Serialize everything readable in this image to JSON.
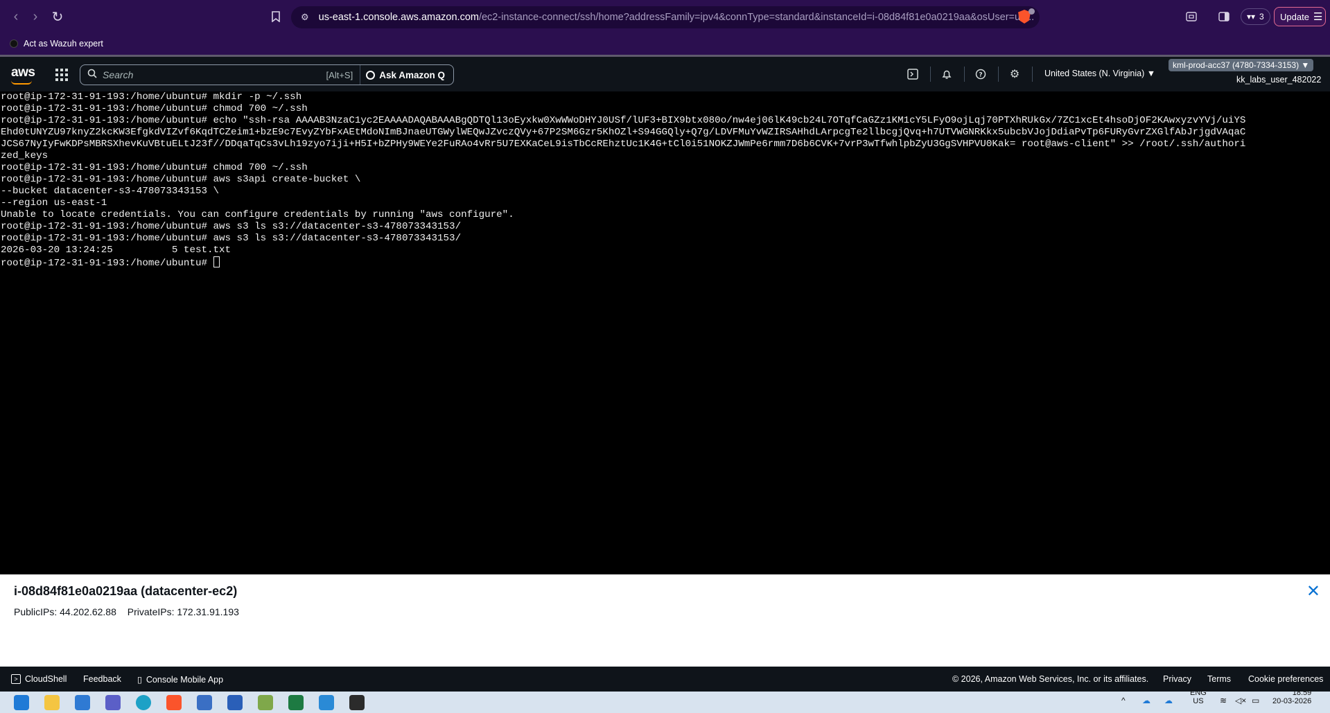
{
  "browser": {
    "url_host": "us-east-1.console.aws.amazon.com",
    "url_path": "/ec2-instance-connect/ssh/home?addressFamily=ipv4&connType=standard&instanceId=i-08d84f81e0a0219aa&osUser=ub...",
    "wallet_count": "3",
    "update_label": "Update"
  },
  "bookmarks": {
    "item": "Act as Wazuh expert"
  },
  "aws_header": {
    "logo": "aws",
    "search_placeholder": "Search",
    "search_shortcut": "[Alt+S]",
    "ask_q": "Ask Amazon Q",
    "region": "United States (N. Virginia) ▼",
    "account": "kml-prod-acc37 (4780-7334-3153) ▼",
    "username": "kk_labs_user_482022"
  },
  "terminal": {
    "lines": [
      "root@ip-172-31-91-193:/home/ubuntu# mkdir -p ~/.ssh",
      "root@ip-172-31-91-193:/home/ubuntu# chmod 700 ~/.ssh",
      "root@ip-172-31-91-193:/home/ubuntu# echo \"ssh-rsa AAAAB3NzaC1yc2EAAAADAQABAAABgQDTQl13oEyxkw0XwWWoDHYJ0USf/lUF3+BIX9btx080o/nw4ej06lK49cb24L7OTqfCaGZz1KM1cY5LFyO9ojLqj70PTXhRUkGx/7ZC1xcEt4hsoDjOF2KAwxyzvYVj/uiYS",
      "Ehd0tUNYZU97knyZ2kcKW3EfgkdVIZvf6KqdTCZeim1+bzE9c7EvyZYbFxAEtMdoNImBJnaeUTGWylWEQwJZvczQVy+67P2SM6Gzr5KhOZl+S94GGQly+Q7g/LDVFMuYvWZIRSAHhdLArpcgTe2llbcgjQvq+h7UTVWGNRKkx5ubcbVJojDdiaPvTp6FURyGvrZXGlfAbJrjgdVAqaC",
      "JCS67NyIyFwKDPsMBRSXhevKuVBtuELtJ23f//DDqaTqCs3vLh19zyo7iji+H5I+bZPHy9WEYe2FuRAo4vRr5U7EXKaCeL9isTbCcREhztUc1K4G+tCl0i51NOKZJWmPe6rmm7D6b6CVK+7vrP3wTfwhlpbZyU3GgSVHPVU0Kak= root@aws-client\" >> /root/.ssh/authori",
      "zed_keys",
      "root@ip-172-31-91-193:/home/ubuntu# chmod 700 ~/.ssh",
      "root@ip-172-31-91-193:/home/ubuntu# aws s3api create-bucket \\",
      "--bucket datacenter-s3-478073343153 \\",
      "--region us-east-1",
      "Unable to locate credentials. You can configure credentials by running \"aws configure\".",
      "root@ip-172-31-91-193:/home/ubuntu# aws s3 ls s3://datacenter-s3-478073343153/",
      "root@ip-172-31-91-193:/home/ubuntu# aws s3 ls s3://datacenter-s3-478073343153/",
      "2026-03-20 13:24:25          5 test.txt"
    ],
    "prompt": "root@ip-172-31-91-193:/home/ubuntu# "
  },
  "instance": {
    "title": "i-08d84f81e0a0219aa (datacenter-ec2)",
    "public_ips": "PublicIPs: 44.202.62.88",
    "private_ips": "PrivateIPs: 172.31.91.193"
  },
  "footer": {
    "cloudshell": "CloudShell",
    "feedback": "Feedback",
    "mobile_app": "Console Mobile App",
    "copyright": "© 2026, Amazon Web Services, Inc. or its affiliates.",
    "privacy": "Privacy",
    "terms": "Terms",
    "cookies": "Cookie preferences"
  },
  "taskbar": {
    "lang": "ENG",
    "lang_sub": "US",
    "time": "18:59",
    "date": "20-03-2026"
  },
  "colors": {
    "browser_bg": "#2b0f4f",
    "aws_header_bg": "#0f141a",
    "aws_accent": "#ff9900",
    "link_blue": "#0972d3"
  }
}
